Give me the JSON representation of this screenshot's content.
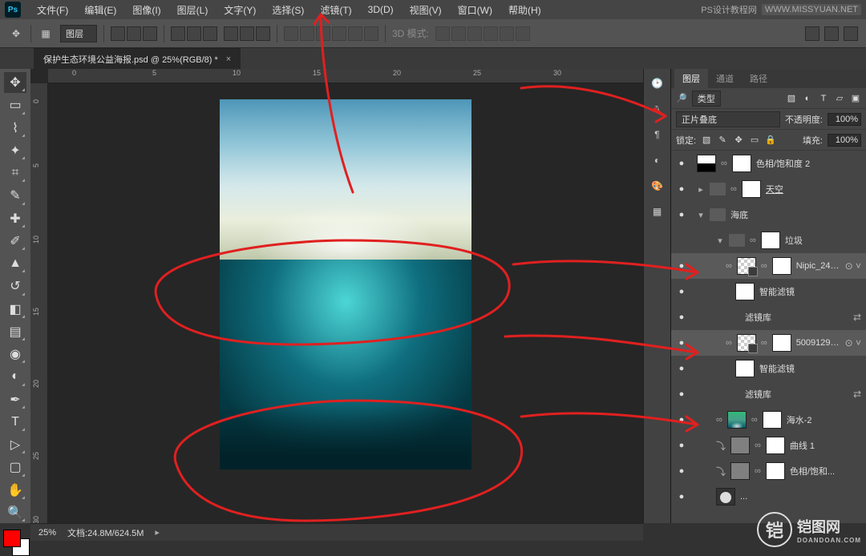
{
  "app": {
    "logo": "Ps"
  },
  "menu": [
    "文件(F)",
    "编辑(E)",
    "图像(I)",
    "图层(L)",
    "文字(Y)",
    "选择(S)",
    "滤镜(T)",
    "3D(D)",
    "视图(V)",
    "窗口(W)",
    "帮助(H)"
  ],
  "menubar_right": [
    "PS设计教程网",
    "WWW.MISSYUAN.NET"
  ],
  "optionsbar": {
    "mode_label": "图层",
    "mode3d": "3D 模式:"
  },
  "doc_tab": "保护生态环境公益海报.psd @ 25%(RGB/8) *",
  "ruler_h": [
    "0",
    "5",
    "10",
    "15",
    "20",
    "25",
    "30"
  ],
  "ruler_v": [
    "0",
    "5",
    "10",
    "15",
    "20",
    "25",
    "30"
  ],
  "status": {
    "zoom": "25%",
    "info": "文档:24.8M/624.5M"
  },
  "panels": {
    "tabs": [
      "图层",
      "通道",
      "路径"
    ],
    "filter": {
      "label": "类型"
    },
    "blend": {
      "mode": "正片叠底",
      "opacity_label": "不透明度:",
      "opacity": "100%"
    },
    "lock": {
      "label": "锁定:",
      "fill_label": "填充:",
      "fill": "100%"
    }
  },
  "layers": [
    {
      "eye": "●",
      "ind": 0,
      "k": "adj",
      "thumb": "half",
      "mask": true,
      "name": "色相/饱和度 2"
    },
    {
      "eye": "●",
      "ind": 0,
      "k": "grp",
      "thumb": "folder",
      "mask": true,
      "name": "天空",
      "tw": "right",
      "ul": true
    },
    {
      "eye": "●",
      "ind": 0,
      "k": "grp",
      "thumb": "folder",
      "name": "海底",
      "tw": "down"
    },
    {
      "eye": "",
      "ind": 2,
      "k": "grp",
      "thumb": "folder",
      "mask": true,
      "name": "垃圾",
      "tw": "down"
    },
    {
      "eye": "●",
      "ind": 3,
      "k": "so",
      "thumb": "checker",
      "mask": true,
      "name": "Nipic_249...",
      "sel": true,
      "smart": "⊙ ˅"
    },
    {
      "eye": "●",
      "ind": 4,
      "k": "sub",
      "name": "智能滤镜"
    },
    {
      "eye": "●",
      "ind": 5,
      "k": "txt",
      "name": "滤镜库",
      "toggle": "⇄"
    },
    {
      "eye": "●",
      "ind": 3,
      "k": "so",
      "thumb": "checker",
      "mask": true,
      "name": "50091292...",
      "sel": true,
      "smart": "⊙ ˅"
    },
    {
      "eye": "●",
      "ind": 4,
      "k": "sub",
      "name": "智能滤镜"
    },
    {
      "eye": "●",
      "ind": 5,
      "k": "txt",
      "name": "滤镜库",
      "toggle": "⇄"
    },
    {
      "eye": "●",
      "ind": 2,
      "k": "img",
      "thumb": "sky",
      "mask": true,
      "name": "海水-2"
    },
    {
      "eye": "●",
      "ind": 2,
      "k": "adj",
      "thumb": "grey",
      "mask": true,
      "name": "曲线 1",
      "glyph": "⤵"
    },
    {
      "eye": "●",
      "ind": 2,
      "k": "adj",
      "thumb": "grey",
      "mask": true,
      "name": "色相/饱和...",
      "glyph": "⤵"
    },
    {
      "eye": "●",
      "ind": 2,
      "k": "adj",
      "thumb": "sun",
      "name": "..."
    }
  ],
  "tools": [
    "move",
    "marquee",
    "lasso",
    "wand",
    "crop",
    "eyedropper",
    "healing",
    "brush",
    "stamp",
    "history",
    "eraser",
    "gradient",
    "blur",
    "dodge",
    "pen",
    "type",
    "path",
    "rect",
    "hand",
    "zoom"
  ],
  "right_strip": [
    "history",
    "char",
    "para",
    "color",
    "swatches",
    "libraries"
  ],
  "watermark": {
    "char": "铠",
    "text": "铠图网",
    "sub": "DOANDOAN.COM"
  }
}
